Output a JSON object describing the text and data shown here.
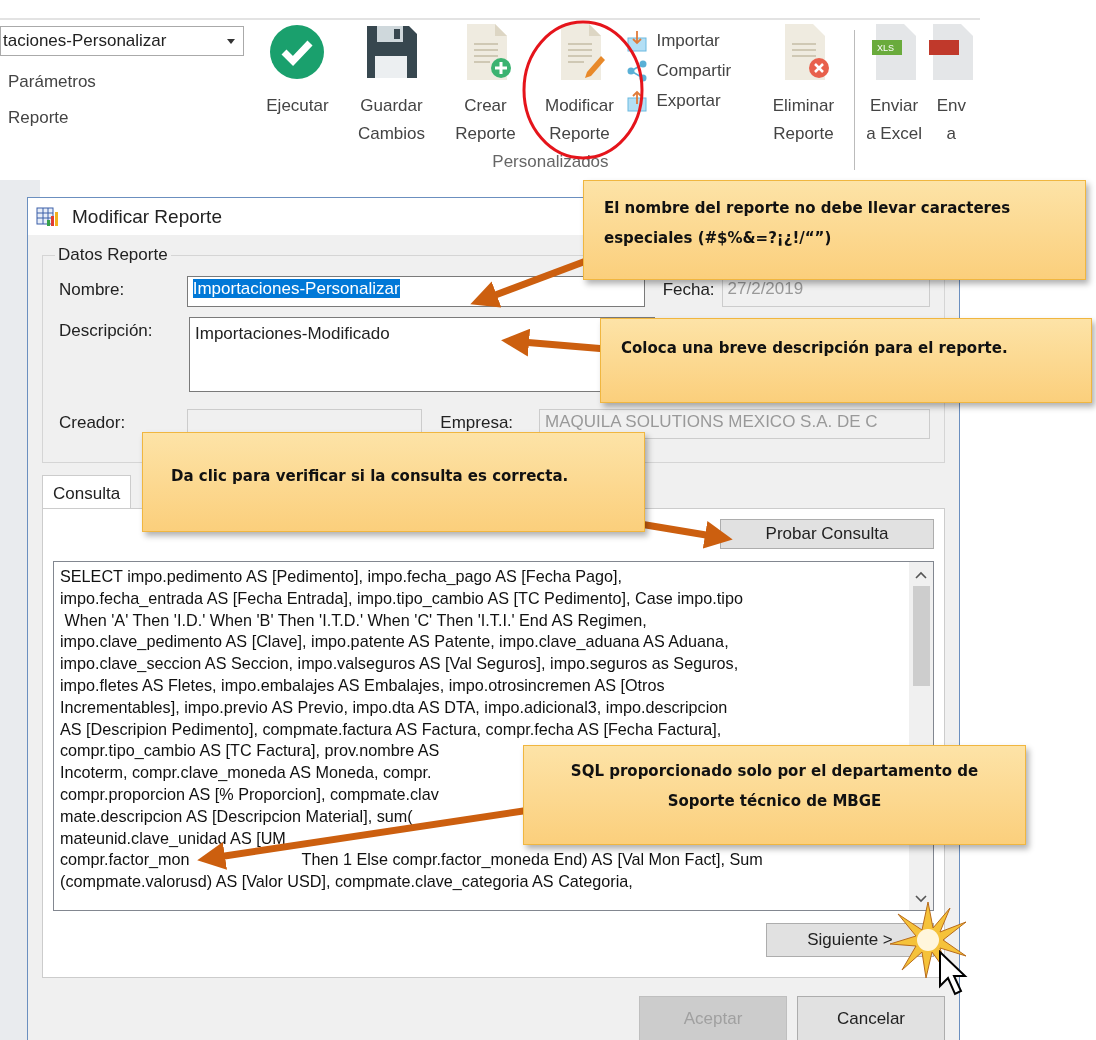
{
  "ribbon": {
    "combo_value": "taciones-Personalizar",
    "links": [
      "Parámetros",
      "Reporte"
    ],
    "buttons": [
      {
        "kind": "check",
        "label": "Ejecutar"
      },
      {
        "kind": "save",
        "label": "Guardar\nCambios"
      },
      {
        "kind": "new",
        "label": "Crear\nReporte"
      },
      {
        "kind": "edit",
        "label": "Modificar\nReporte",
        "highlighted": true
      }
    ],
    "stacked": [
      {
        "kind": "import",
        "label": "Importar"
      },
      {
        "kind": "share",
        "label": "Compartir"
      },
      {
        "kind": "export",
        "label": "Exportar"
      }
    ],
    "after": [
      {
        "kind": "delete",
        "label": "Eliminar\nReporte"
      }
    ],
    "group_label": "Personalizados",
    "export_buttons": [
      {
        "kind": "excel",
        "label": "Enviar\na Excel",
        "badge": "XLS"
      },
      {
        "kind": "pdf",
        "label": "Env\na"
      }
    ]
  },
  "dialog": {
    "title": "Modificar Reporte",
    "group_title": "Datos Reporte",
    "name_label": "Nombre:",
    "name_value": "Importaciones-Personalizar",
    "date_label": "Fecha:",
    "date_value": "27/2/2019",
    "description_label": "Descripción:",
    "description_value": "Importaciones-Modificado",
    "creator_label": "Creador:",
    "company_label": "Empresa:",
    "company_value": "MAQUILA SOLUTIONS MEXICO S.A. DE C",
    "tab": "Consulta",
    "test_button": "Probar Consulta",
    "sql_lines": [
      "SELECT impo.pedimento AS [Pedimento], impo.fecha_pago AS [Fecha Pago],",
      "impo.fecha_entrada AS [Fecha Entrada], impo.tipo_cambio AS [TC Pedimento], Case impo.tipo",
      " When 'A' Then 'I.D.' When 'B' Then 'I.T.D.' When 'C' Then 'I.T.I.' End AS Regimen,",
      "impo.clave_pedimento AS [Clave], impo.patente AS Patente, impo.clave_aduana AS Aduana,",
      "impo.clave_seccion AS Seccion, impo.valseguros AS [Val Seguros], impo.seguros as Seguros,",
      "impo.fletes AS Fletes, impo.embalajes AS Embalajes, impo.otrosincremen AS [Otros",
      "Incrementables], impo.previo AS Previo, impo.dta AS DTA, impo.adicional3, impo.descripcion",
      "AS [Descripion Pedimento], compmate.factura AS Factura, compr.fecha AS [Fecha Factura],",
      "compr.tipo_cambio AS [TC Factura], prov.nombre AS",
      "Incoterm, compr.clave_moneda AS Moneda, compr.",
      "compr.proporcion AS [% Proporcion], compmate.clav",
      "mate.descripcion AS [Descripcion Material], sum(",
      "mateunid.clave_unidad AS [UM",
      "compr.factor_mon",
      "(compmate.valorusd) AS [Valor USD], compmate.clave_categoria AS Categoria,"
    ],
    "sql_line_14_tail": "Then 1 Else compr.factor_moneda End) AS [Val Mon Fact], Sum",
    "next_button": "Siguiente >",
    "buttons": [
      {
        "label": "Aceptar",
        "disabled": true
      },
      {
        "label": "Cancelar",
        "disabled": false
      }
    ]
  },
  "callouts": [
    "El nombre del reporte no debe llevar caracteres especiales (#$%&=?¡¿!/“”)",
    "Coloca una breve descripción para el reporte.",
    "Da clic para verificar si la consulta es correcta.",
    "SQL proporcionado solo por el departamento de Soporte técnico de  MBGE"
  ]
}
